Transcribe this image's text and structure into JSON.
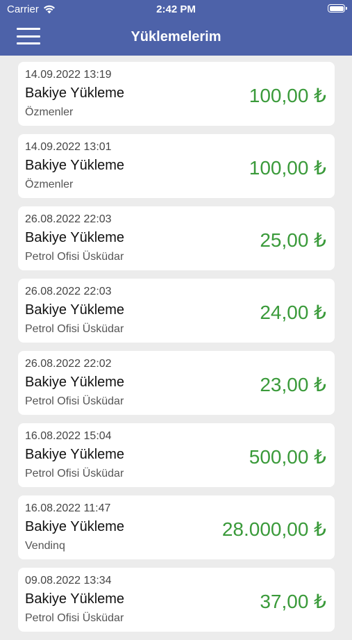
{
  "status_bar": {
    "carrier": "Carrier",
    "time": "2:42 PM"
  },
  "header": {
    "title": "Yüklemelerim"
  },
  "colors": {
    "header_bg": "#4d62a9",
    "amount": "#3a9a3a",
    "background": "#ececec"
  },
  "transactions": [
    {
      "date": "14.09.2022 13:19",
      "title": "Bakiye Yükleme",
      "place": "Özmenler",
      "amount": "100,00 ₺"
    },
    {
      "date": "14.09.2022 13:01",
      "title": "Bakiye Yükleme",
      "place": "Özmenler",
      "amount": "100,00 ₺"
    },
    {
      "date": "26.08.2022 22:03",
      "title": "Bakiye Yükleme",
      "place": "Petrol Ofisi Üsküdar",
      "amount": "25,00 ₺"
    },
    {
      "date": "26.08.2022 22:03",
      "title": "Bakiye Yükleme",
      "place": "Petrol Ofisi Üsküdar",
      "amount": "24,00 ₺"
    },
    {
      "date": "26.08.2022 22:02",
      "title": "Bakiye Yükleme",
      "place": "Petrol Ofisi Üsküdar",
      "amount": "23,00 ₺"
    },
    {
      "date": "16.08.2022 15:04",
      "title": "Bakiye Yükleme",
      "place": "Petrol Ofisi Üsküdar",
      "amount": "500,00 ₺"
    },
    {
      "date": "16.08.2022 11:47",
      "title": "Bakiye Yükleme",
      "place": "Vendinq",
      "amount": "28.000,00 ₺"
    },
    {
      "date": "09.08.2022 13:34",
      "title": "Bakiye Yükleme",
      "place": "Petrol Ofisi Üsküdar",
      "amount": "37,00 ₺"
    }
  ]
}
